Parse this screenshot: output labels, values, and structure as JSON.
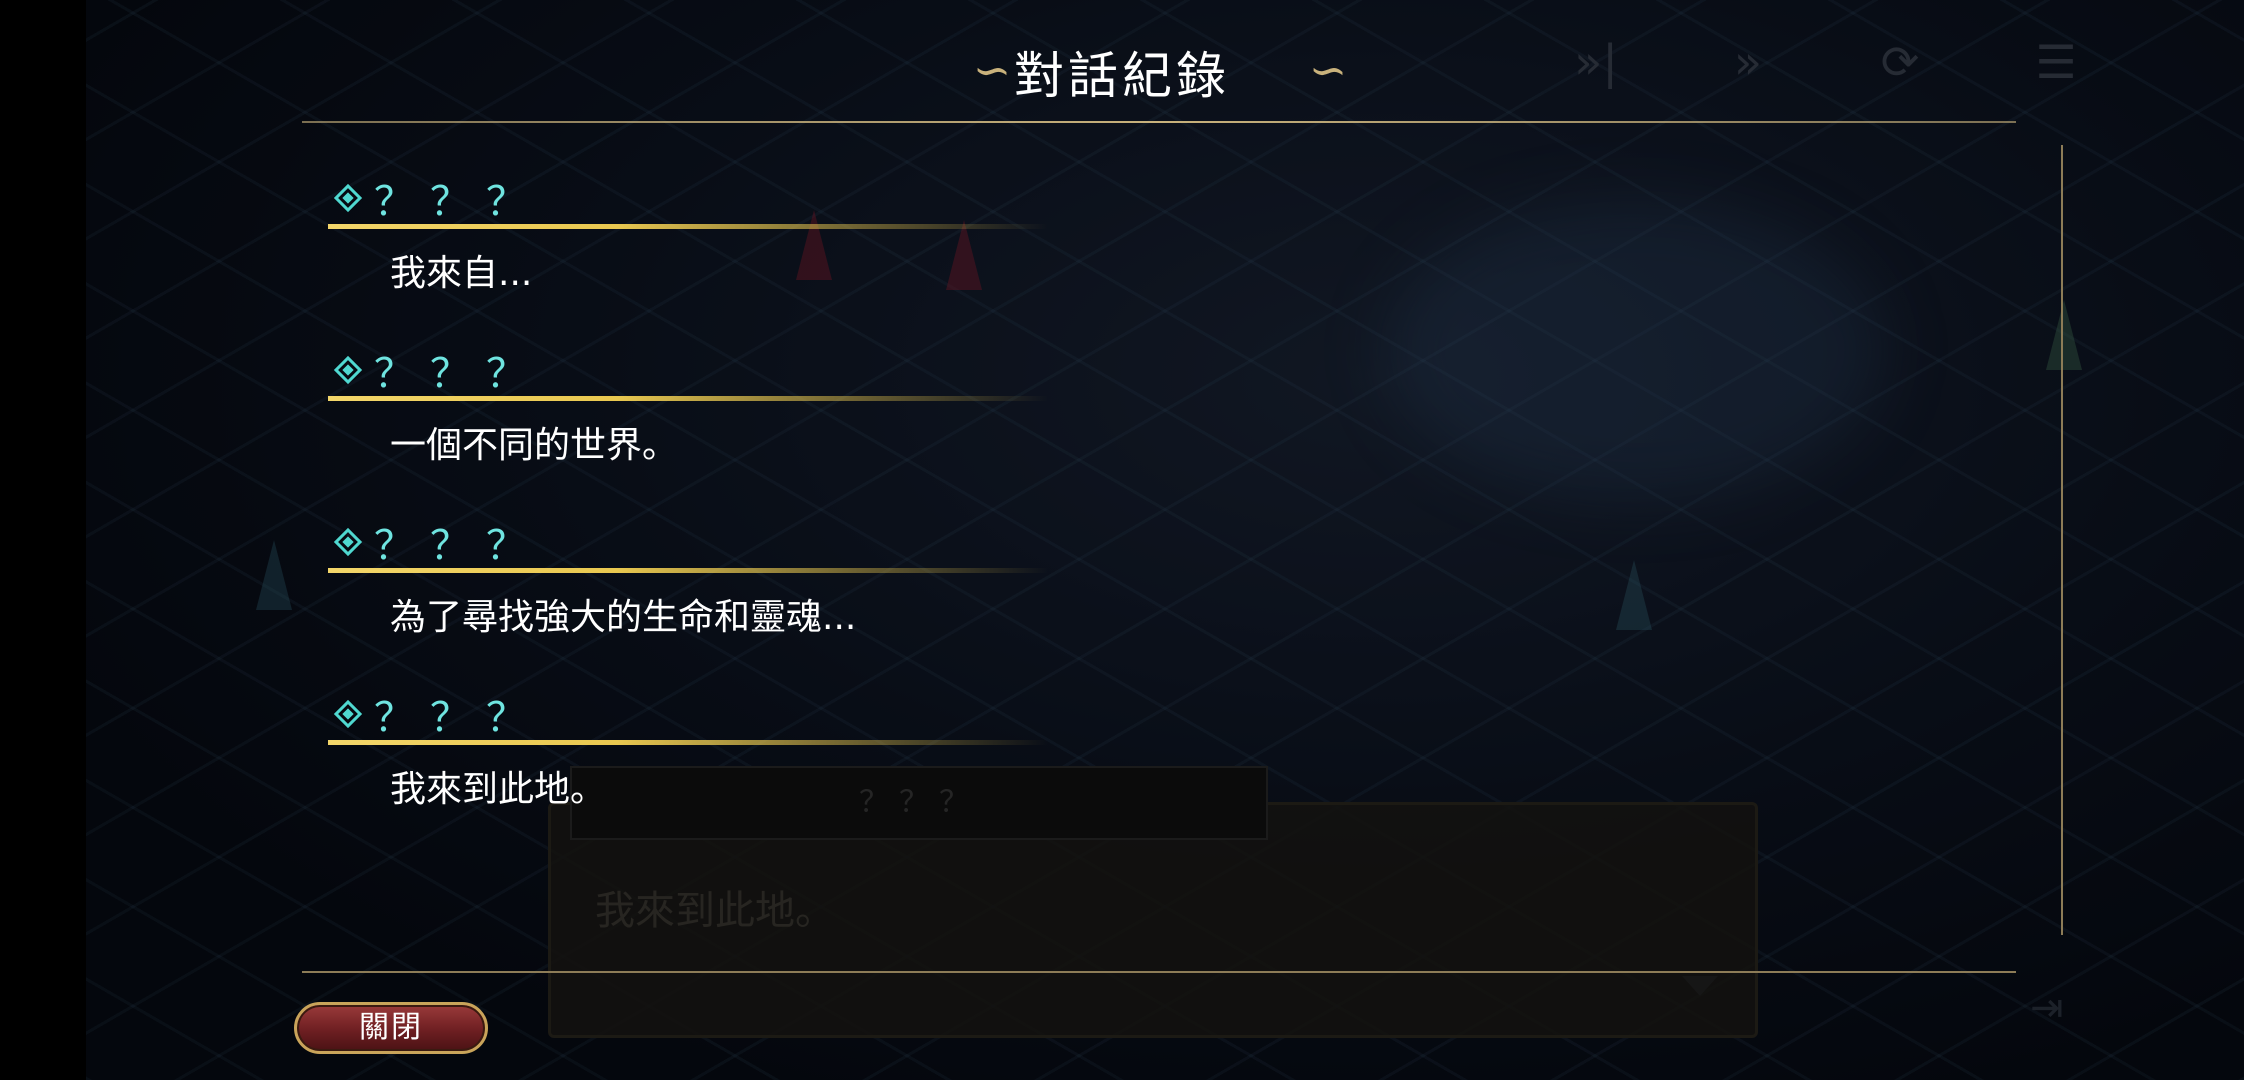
{
  "log": {
    "title": "對話紀錄",
    "entries": [
      {
        "speaker": "？？？",
        "text": "我來自..."
      },
      {
        "speaker": "？？？",
        "text": "一個不同的世界。"
      },
      {
        "speaker": "？？？",
        "text": "為了尋找強大的生命和靈魂..."
      },
      {
        "speaker": "？？？",
        "text": "我來到此地。"
      }
    ],
    "close_label": "關閉"
  },
  "game_dialog": {
    "speaker": "？？？",
    "text": "我來到此地。"
  },
  "hud": {
    "icons": [
      "skip-icon",
      "fast-forward-icon",
      "auto-play-icon",
      "log-icon"
    ]
  },
  "colors": {
    "speaker": "#6fe4e0",
    "underline": "#e9c850",
    "frame": "#c9b27c",
    "button": "#6e1f22"
  }
}
